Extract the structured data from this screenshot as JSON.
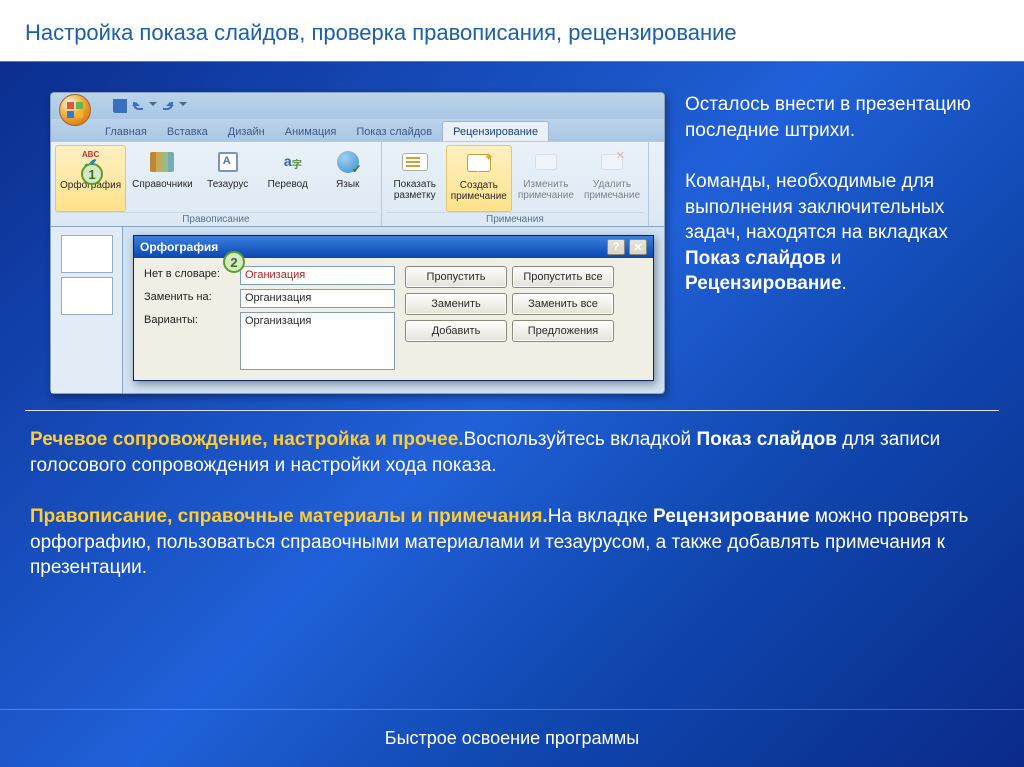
{
  "slide_title": "Настройка показа слайдов, проверка правописания, рецензирование",
  "ribbon": {
    "tabs": [
      "Главная",
      "Вставка",
      "Дизайн",
      "Анимация",
      "Показ слайдов",
      "Рецензирование"
    ],
    "active_tab_index": 5,
    "groups": {
      "proofing": {
        "label": "Правописание",
        "buttons": {
          "spelling": "Орфография",
          "research": "Справочники",
          "thesaurus": "Тезаурус",
          "translate": "Перевод",
          "language": "Язык"
        }
      },
      "comments": {
        "label": "Примечания",
        "buttons": {
          "show": "Показать\nразметку",
          "new": "Создать\nпримечание",
          "edit": "Изменить\nпримечание",
          "delete": "Удалить\nпримечание"
        }
      }
    }
  },
  "dialog": {
    "title": "Орфография",
    "labels": {
      "not_in_dict": "Нет в словаре:",
      "change_to": "Заменить на:",
      "variants": "Варианты:"
    },
    "values": {
      "not_in_dict": "Оганизация",
      "change_to": "Организация",
      "variants": "Организация"
    },
    "buttons": {
      "ignore": "Пропустить",
      "ignore_all": "Пропустить все",
      "change": "Заменить",
      "change_all": "Заменить все",
      "add": "Добавить",
      "suggest": "Предложения"
    }
  },
  "markers": {
    "one": "1",
    "two": "2"
  },
  "intro": {
    "p1": "Осталось внести в презентацию последние штрихи.",
    "p2_a": "Команды, необходимые для выполнения заключительных задач, находятся на вкладках ",
    "p2_b": "Показ слайдов",
    "p2_c": " и ",
    "p2_d": "Рецензирование",
    "p2_e": "."
  },
  "lower": {
    "h1": "Речевое сопровождение, настройка и прочее.",
    "t1_a": "Воспользуйтесь вкладкой ",
    "t1_b": "Показ слайдов",
    "t1_c": " для записи голосового сопровождения и настройки хода показа.",
    "h2": "Правописание, справочные материалы и примечания.",
    "t2_a": "На вкладке ",
    "t2_b": "Рецензирование",
    "t2_c": " можно проверять орфографию, пользоваться справочными материалами и тезаурусом, а также добавлять примечания к презентации."
  },
  "footer": "Быстрое освоение программы"
}
